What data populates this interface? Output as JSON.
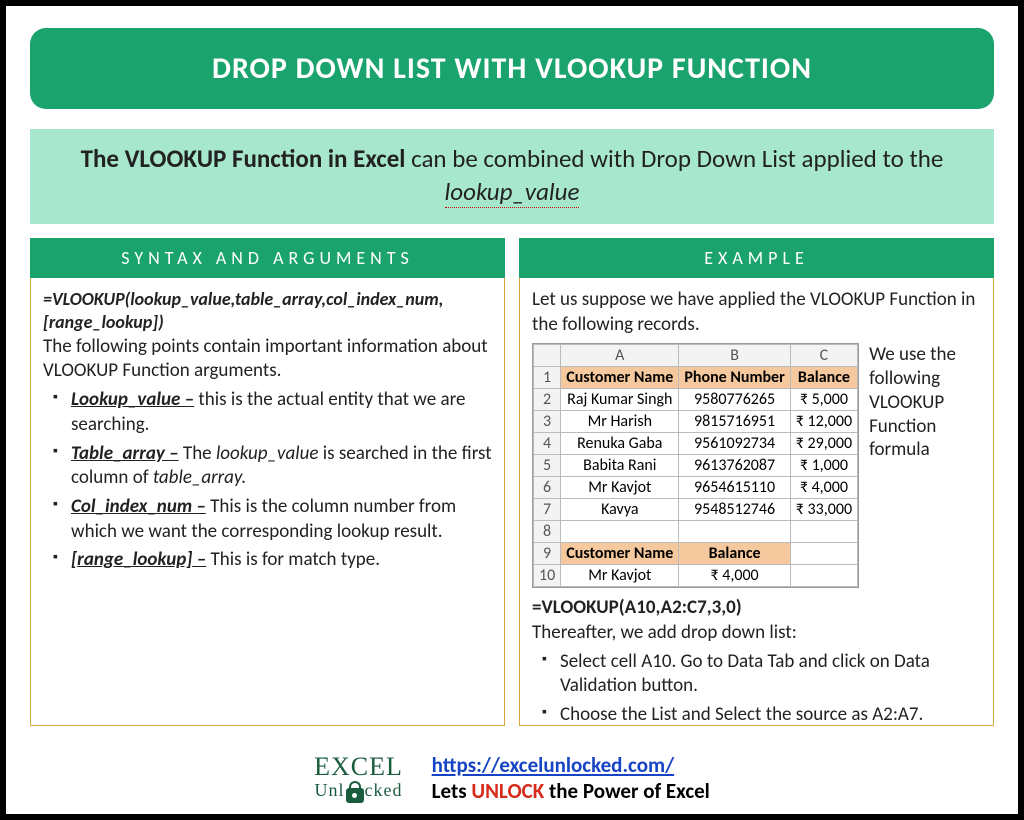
{
  "title": "DROP DOWN LIST WITH VLOOKUP FUNCTION",
  "intro": {
    "bold": "The VLOOKUP Function in Excel",
    "rest1": " can be combined with Drop Down List applied to the ",
    "em": "lookup_value"
  },
  "left": {
    "header": "SYNTAX AND ARGUMENTS",
    "syntax": "=VLOOKUP(lookup_value,table_array,col_index_num,[range_lookup])",
    "lead": "The following points contain important information about VLOOKUP Function arguments.",
    "args": [
      {
        "name": "Lookup_value –",
        "desc": " this is the actual entity that we are searching."
      },
      {
        "name": "Table_array –",
        "desc_pre": " The ",
        "desc_it": "lookup_value",
        "desc_mid": " is searched in the first column of ",
        "desc_it2": "table_array."
      },
      {
        "name": "Col_index_num –",
        "desc": " This is the column number from which we want the corresponding lookup result."
      },
      {
        "name": "[range_lookup] –",
        "desc": " This is for match type."
      }
    ]
  },
  "right": {
    "header": "EXAMPLE",
    "lead": "Let us suppose we have applied the VLOOKUP Function in the following records.",
    "side_note": "We use the following VLOOKUP Function formula",
    "table": {
      "cols": [
        "A",
        "B",
        "C"
      ],
      "headers": [
        "Customer Name",
        "Phone Number",
        "Balance"
      ],
      "rows": [
        [
          "Raj Kumar Singh",
          "9580776265",
          "₹ 5,000"
        ],
        [
          "Mr Harish",
          "9815716951",
          "₹ 12,000"
        ],
        [
          "Renuka Gaba",
          "9561092734",
          "₹ 29,000"
        ],
        [
          "Babita Rani",
          "9613762087",
          "₹ 1,000"
        ],
        [
          "Mr Kavjot",
          "9654615110",
          "₹ 4,000"
        ],
        [
          "Kavya",
          "9548512746",
          "₹ 33,000"
        ]
      ],
      "result_headers": [
        "Customer Name",
        "Balance"
      ],
      "result_row": [
        "Mr Kavjot",
        "₹ 4,000"
      ]
    },
    "formula": "=VLOOKUP(A10,A2:C7,3,0)",
    "after": "Thereafter, we add drop down list:",
    "steps": [
      "Select cell A10. Go to Data Tab and click on Data Validation button.",
      "Choose the List and Select the source as A2:A7."
    ]
  },
  "footer": {
    "logo_left": "EXCE",
    "logo_right": "L",
    "logo_sub": "Unl   cked",
    "url": "https://excelunlocked.com/",
    "tag_pre": "Lets ",
    "tag_unlock": "UNLOCK",
    "tag_post": " the Power of Excel"
  }
}
